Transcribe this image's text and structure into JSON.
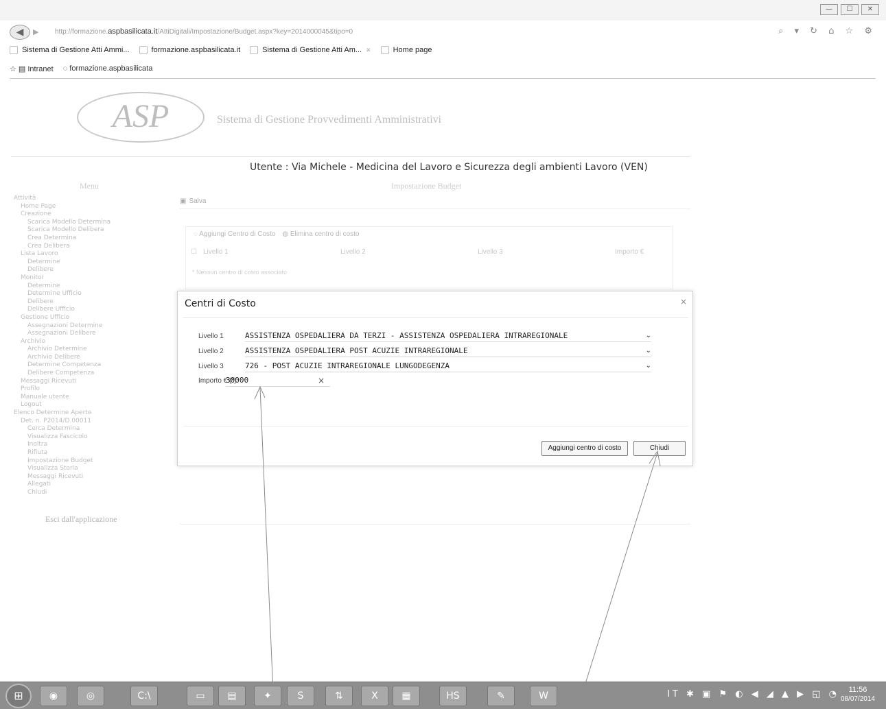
{
  "browser": {
    "url_prefix": "http://formazione.",
    "url_host": "aspbasilicata.it",
    "url_path": "/AttiDigitali/Impostazione/Budget.aspx?key=2014000045&tipo=0",
    "tabs": [
      {
        "label": "Sistema di Gestione Atti Ammi..."
      },
      {
        "label": "formazione.aspbasilicata.it"
      },
      {
        "label": "Sistema di Gestione Atti Am..."
      },
      {
        "label": "Home page"
      }
    ],
    "favorites": {
      "item1": "Intranet",
      "item2": "formazione.aspbasilicata"
    },
    "window_controls": {
      "minimize": "—",
      "maximize": "☐",
      "close": "✕"
    },
    "address_icons": "⌕ ▾ ↻  ⌂ ☆ ⚙"
  },
  "app": {
    "logo_text": "ASP",
    "title": "Sistema di Gestione Provvedimenti Amministrativi",
    "user_line": "Utente : Via Michele - Medicina del Lavoro e Sicurezza degli ambienti Lavoro (VEN)",
    "menu_heading": "Menu",
    "section_title": "Impostazione Budget"
  },
  "sidebar": {
    "items": [
      {
        "label": "Attività",
        "level": 0
      },
      {
        "label": "Home Page",
        "level": 1
      },
      {
        "label": "Creazione",
        "level": 1
      },
      {
        "label": "Scarica Modello Determina",
        "level": 2
      },
      {
        "label": "Scarica Modello Delibera",
        "level": 2
      },
      {
        "label": "Crea Determina",
        "level": 2
      },
      {
        "label": "Crea Delibera",
        "level": 2
      },
      {
        "label": "Lista Lavoro",
        "level": 1
      },
      {
        "label": "Determine",
        "level": 2
      },
      {
        "label": "Delibere",
        "level": 2
      },
      {
        "label": "Monitor",
        "level": 1
      },
      {
        "label": "Determine",
        "level": 2
      },
      {
        "label": "Determine Ufficio",
        "level": 2
      },
      {
        "label": "Delibere",
        "level": 2
      },
      {
        "label": "Delibere Ufficio",
        "level": 2
      },
      {
        "label": "Gestione Ufficio",
        "level": 1
      },
      {
        "label": "Assegnazioni Determine",
        "level": 2
      },
      {
        "label": "Assegnazioni Delibere",
        "level": 2
      },
      {
        "label": "Archivio",
        "level": 1
      },
      {
        "label": "Archivio Determine",
        "level": 2
      },
      {
        "label": "Archivio Delibere",
        "level": 2
      },
      {
        "label": "Determine Competenza",
        "level": 2
      },
      {
        "label": "Delibere Competenza",
        "level": 2
      },
      {
        "label": "Messaggi Ricevuti",
        "level": 1
      },
      {
        "label": "Profilo",
        "level": 1
      },
      {
        "label": "Manuale utente",
        "level": 1
      },
      {
        "label": "Logout",
        "level": 1
      },
      {
        "label": "Elenco Determine Aperte",
        "level": 0
      },
      {
        "label": "Det. n. P2014/D.00011",
        "level": 1
      },
      {
        "label": "Cerca Determina",
        "level": 2
      },
      {
        "label": "Visualizza Fascicolo",
        "level": 2
      },
      {
        "label": "Inoltra",
        "level": 2
      },
      {
        "label": "Rifiuta",
        "level": 2
      },
      {
        "label": "Impostazione Budget",
        "level": 2
      },
      {
        "label": "Visualizza Storia",
        "level": 2
      },
      {
        "label": "Messaggi Ricevuti",
        "level": 2
      },
      {
        "label": "Allegati",
        "level": 2
      },
      {
        "label": "Chiudi",
        "level": 2
      }
    ],
    "exit_label": "Esci dall'applicazione"
  },
  "background": {
    "save_label": "Salva",
    "add_cost_center": "Aggiungi Centro di Costo",
    "remove_cost_center": "Elimina centro di costo",
    "headers": [
      "Livello 1",
      "Livello 2",
      "Livello 3",
      "Importo €"
    ],
    "note": "* Nessun centro di costo associato"
  },
  "modal": {
    "title": "Centri di Costo",
    "close_icon": "×",
    "fields": [
      {
        "label": "Livello 1",
        "value": "ASSISTENZA OSPEDALIERA DA TERZI - ASSISTENZA OSPEDALIERA INTRAREGIONALE"
      },
      {
        "label": "Livello 2",
        "value": "ASSISTENZA OSPEDALIERA POST ACUZIE INTRAREGIONALE"
      },
      {
        "label": "Livello 3",
        "value": "726 - POST ACUZIE INTRAREGIONALE LUNGODEGENZA"
      }
    ],
    "amount_label": "Importo € (*)",
    "amount_value": "30000",
    "clear_icon": "×",
    "chevron": "⌄",
    "add_button": "Aggiungi centro di costo",
    "close_button": "Chiudi"
  },
  "taskbar": {
    "start_icon": "⊞",
    "language": "IT",
    "time": "11:56",
    "date": "08/07/2014",
    "apps": [
      "firefox-icon",
      "chrome-icon",
      "cmd-icon",
      "explorer-icon",
      "file-icon",
      "puzzle-icon",
      "app-icon",
      "excel-icon",
      "word-doc-icon",
      "game-icon",
      "hs-icon",
      "tools-icon",
      "word-icon"
    ],
    "app_glyphs": [
      "◉",
      "◎",
      "C:\\",
      "▭",
      "▤",
      "✦",
      "S",
      "⇅",
      "X",
      "▦",
      "HS",
      "✎",
      "W"
    ]
  },
  "colors": {
    "accent": "#333333",
    "taskbar": "#8e8e8e",
    "faded_text": "#bdbdbd"
  }
}
